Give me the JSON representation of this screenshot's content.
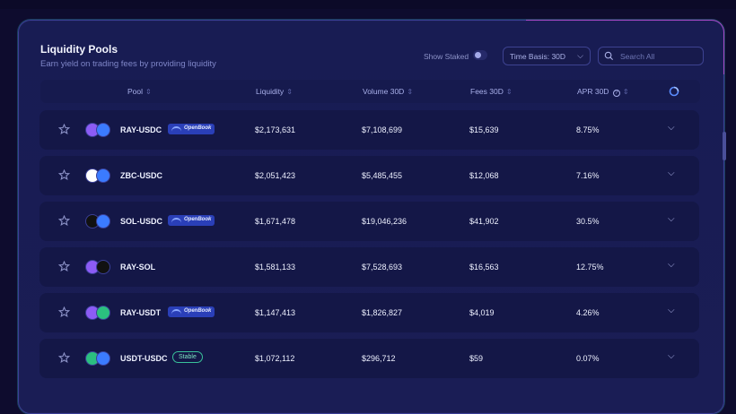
{
  "header": {
    "title": "Liquidity Pools",
    "subtitle": "Earn yield on trading fees by providing liquidity",
    "show_staked_label": "Show Staked",
    "time_basis_label": "Time Basis: 30D",
    "search_placeholder": "Search All"
  },
  "columns": [
    "Pool",
    "Liquidity",
    "Volume 30D",
    "Fees 30D",
    "APR 30D"
  ],
  "colors": {
    "background": "#0e0c2e",
    "panel": "#181c53",
    "row": "#141747",
    "openbook_badge": "#2a3fb8",
    "stable_badge": "#39c19a"
  },
  "icons": {
    "star": "star-icon",
    "chevron": "chevron-down-icon",
    "search": "search-icon",
    "refresh": "refresh-icon",
    "info": "info-icon"
  },
  "rows": [
    {
      "pair": "RAY-USDC",
      "badge": "OpenBook",
      "liquidity": "$2,173,631",
      "volume": "$7,108,699",
      "fees": "$15,639",
      "apr": "8.75%"
    },
    {
      "pair": "ZBC-USDC",
      "badge": "",
      "liquidity": "$2,051,423",
      "volume": "$5,485,455",
      "fees": "$12,068",
      "apr": "7.16%"
    },
    {
      "pair": "SOL-USDC",
      "badge": "OpenBook",
      "liquidity": "$1,671,478",
      "volume": "$19,046,236",
      "fees": "$41,902",
      "apr": "30.5%"
    },
    {
      "pair": "RAY-SOL",
      "badge": "",
      "liquidity": "$1,581,133",
      "volume": "$7,528,693",
      "fees": "$16,563",
      "apr": "12.75%"
    },
    {
      "pair": "RAY-USDT",
      "badge": "OpenBook",
      "liquidity": "$1,147,413",
      "volume": "$1,826,827",
      "fees": "$4,019",
      "apr": "4.26%"
    },
    {
      "pair": "USDT-USDC",
      "badge": "Stable",
      "liquidity": "$1,072,112",
      "volume": "$296,712",
      "fees": "$59",
      "apr": "0.07%"
    }
  ]
}
